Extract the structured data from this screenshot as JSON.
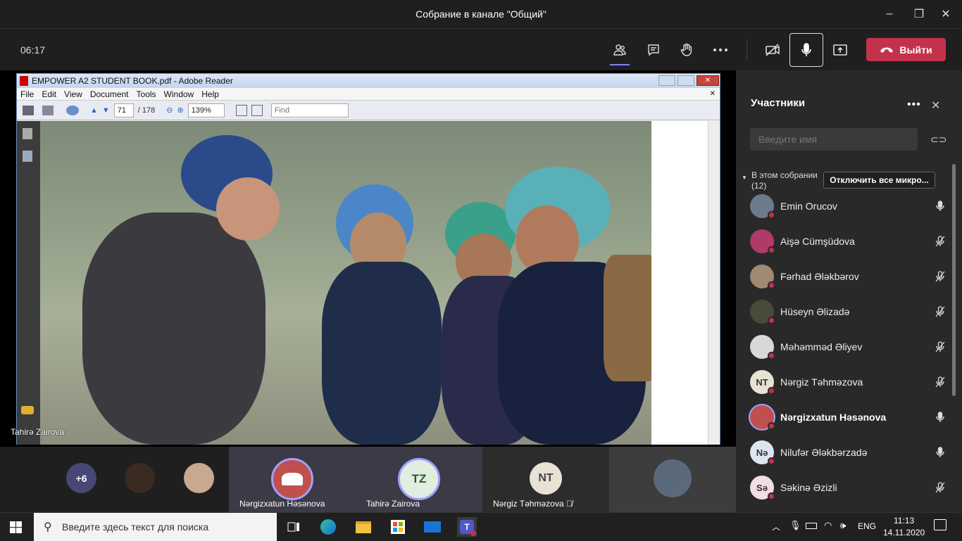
{
  "window": {
    "title": "Собрание в канале \"Общий\"",
    "minimize": "–",
    "maximize": "❐",
    "close": "✕"
  },
  "toolbar": {
    "timer": "06:17",
    "leave_label": "Выйти"
  },
  "reader": {
    "title": "EMPOWER A2 STUDENT BOOK.pdf - Adobe Reader",
    "menu": [
      "File",
      "Edit",
      "View",
      "Document",
      "Tools",
      "Window",
      "Help"
    ],
    "page": "71",
    "total_pages": "/ 178",
    "zoom": "139%",
    "find_placeholder": "Find"
  },
  "stage": {
    "presenter_name": "Tahirə Zairova"
  },
  "participants_panel": {
    "title": "Участники",
    "search_placeholder": "Введите имя",
    "section_label": "В этом собрании",
    "section_count": "(12)",
    "mute_all": "Отключить все микро...",
    "participants": [
      {
        "name": "Emin Orucov",
        "initials": "",
        "avatar_color": "#6b7b8c",
        "muted": false,
        "bold": false
      },
      {
        "name": "Aişə Cümşüdova",
        "initials": "",
        "avatar_color": "#b03a6a",
        "muted": true,
        "bold": false
      },
      {
        "name": "Fərhad Ələkbərov",
        "initials": "",
        "avatar_color": "#a08872",
        "muted": true,
        "bold": false
      },
      {
        "name": "Hüseyn Əlizadə",
        "initials": "",
        "avatar_color": "#4a4a3a",
        "muted": true,
        "bold": false
      },
      {
        "name": "Məhəmməd Əliyev",
        "initials": "",
        "avatar_color": "#d8d8d8",
        "muted": true,
        "bold": false
      },
      {
        "name": "Nərgiz Təhməzova",
        "initials": "NT",
        "avatar_color": "#e8e2d4",
        "muted": true,
        "bold": false
      },
      {
        "name": "Nərgizxatun Həsənova",
        "initials": "",
        "avatar_color": "#c0504d",
        "muted": false,
        "bold": true
      },
      {
        "name": "Nilufər Ələkbərzadə",
        "initials": "Nə",
        "avatar_color": "#dde4f2",
        "muted": false,
        "bold": false
      },
      {
        "name": "Səkinə Əzizli",
        "initials": "Sə",
        "avatar_color": "#f2dde4",
        "muted": true,
        "bold": false
      }
    ]
  },
  "bottom_strip": {
    "overflow_count": "+6",
    "tiles": [
      {
        "name": "Nərgizxatun Həsənova",
        "initials": ""
      },
      {
        "name": "Tahirə Zairova",
        "initials": "TZ"
      },
      {
        "name": "Nərgiz Təhməzova",
        "initials": "NT"
      }
    ]
  },
  "taskbar": {
    "search_placeholder": "Введите здесь текст для поиска",
    "language": "ENG",
    "time": "11:13",
    "date": "14.11.2020"
  },
  "colors": {
    "leave": "#c4314b",
    "accent": "#6264a7",
    "presence_busy": "#c4314b"
  }
}
